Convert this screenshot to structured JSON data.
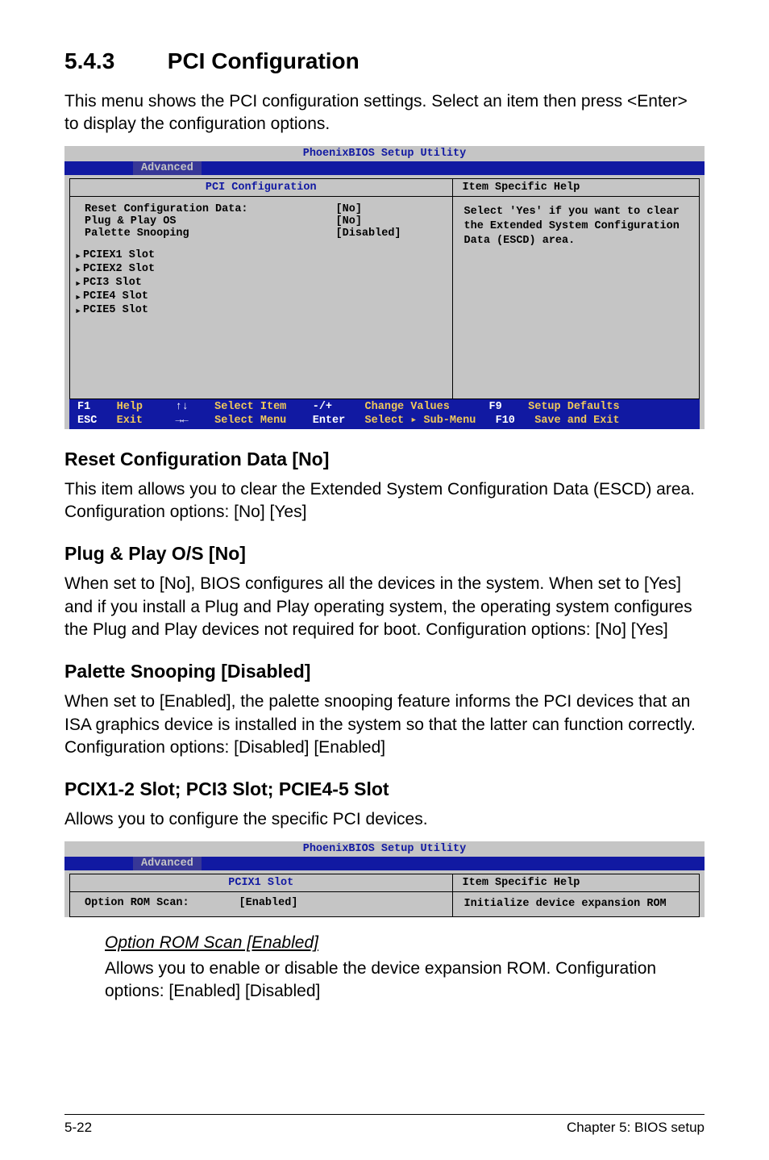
{
  "heading_number": "5.4.3",
  "heading_title": "PCI Configuration",
  "intro": "This menu shows the PCI configuration settings. Select an item then press <Enter> to display the configuration options.",
  "bios1": {
    "title": "PhoenixBIOS Setup Utility",
    "tab": "Advanced",
    "panel_title": "PCI Configuration",
    "right_title": "Item Specific Help",
    "rows": {
      "r0_label": "Reset Configuration Data:",
      "r0_val": "[No]",
      "r1_label": "Plug & Play OS",
      "r1_val": "[No]",
      "r2_label": "Palette Snooping",
      "r2_val": "[Disabled]",
      "s0": "PCIEX1 Slot",
      "s1": "PCIEX2 Slot",
      "s2": "PCI3 Slot",
      "s3": "PCIE4 Slot",
      "s4": "PCIE5 Slot"
    },
    "help": "Select 'Yes' if you want to clear the Extended System Configuration Data (ESCD) area.",
    "footer": {
      "f1": "F1",
      "help": "Help",
      "arrows_ud": "↑↓",
      "select_item": "Select Item",
      "pm": "-/+",
      "change": "Change Values",
      "f9": "F9",
      "defaults": "Setup Defaults",
      "esc": "ESC",
      "exit": "Exit",
      "arrows_lr": "→←",
      "select_menu": "Select Menu",
      "enter": "Enter",
      "select_sub": "Select ▸ Sub-Menu",
      "f10": "F10",
      "save": "Save and Exit"
    }
  },
  "sec1_h": "Reset Configuration Data [No]",
  "sec1_p": "This item allows you to clear the Extended System Configuration Data (ESCD) area. Configuration options: [No] [Yes]",
  "sec2_h": "Plug & Play O/S [No]",
  "sec2_p": "When set to [No], BIOS configures all the devices in the system. When set to [Yes] and if you install a Plug and Play operating system, the operating system configures the Plug and Play devices not required for boot. Configuration options: [No] [Yes]",
  "sec3_h": "Palette Snooping [Disabled]",
  "sec3_p": "When set to [Enabled], the palette snooping feature informs the PCI devices that an ISA graphics device is installed in the system so that the latter can function correctly. Configuration options: [Disabled] [Enabled]",
  "sec4_h": "PCIX1-2 Slot; PCI3 Slot; PCIE4-5 Slot",
  "sec4_p": "Allows you to configure the specific PCI devices.",
  "bios2": {
    "title": "PhoenixBIOS Setup Utility",
    "tab": "Advanced",
    "panel_title": "PCIX1 Slot",
    "right_title": "Item Specific Help",
    "row_label": "Option ROM Scan:",
    "row_val": "[Enabled]",
    "help": "Initialize device expansion ROM"
  },
  "sub_h": "Option ROM Scan [Enabled]",
  "sub_p": "Allows you to enable or disable the device expansion ROM. Configuration options: [Enabled] [Disabled]",
  "page_footer_left": "5-22",
  "page_footer_right": "Chapter 5: BIOS setup"
}
